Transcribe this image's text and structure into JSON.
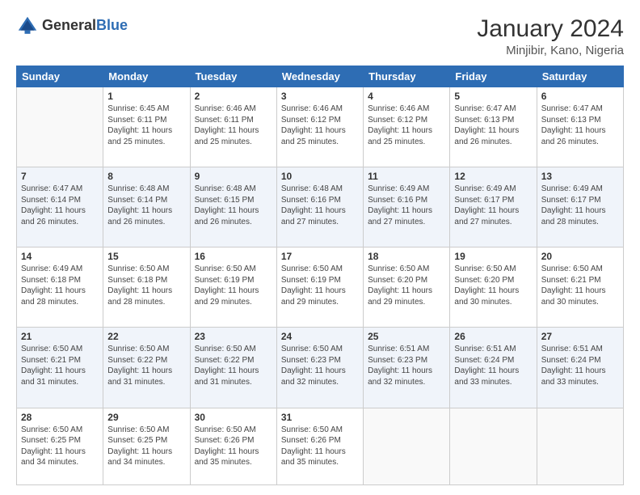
{
  "logo": {
    "text_general": "General",
    "text_blue": "Blue"
  },
  "header": {
    "month_year": "January 2024",
    "location": "Minjibir, Kano, Nigeria"
  },
  "weekdays": [
    "Sunday",
    "Monday",
    "Tuesday",
    "Wednesday",
    "Thursday",
    "Friday",
    "Saturday"
  ],
  "weeks": [
    [
      {
        "day": "",
        "sunrise": "",
        "sunset": "",
        "daylight": ""
      },
      {
        "day": "1",
        "sunrise": "Sunrise: 6:45 AM",
        "sunset": "Sunset: 6:11 PM",
        "daylight": "Daylight: 11 hours and 25 minutes."
      },
      {
        "day": "2",
        "sunrise": "Sunrise: 6:46 AM",
        "sunset": "Sunset: 6:11 PM",
        "daylight": "Daylight: 11 hours and 25 minutes."
      },
      {
        "day": "3",
        "sunrise": "Sunrise: 6:46 AM",
        "sunset": "Sunset: 6:12 PM",
        "daylight": "Daylight: 11 hours and 25 minutes."
      },
      {
        "day": "4",
        "sunrise": "Sunrise: 6:46 AM",
        "sunset": "Sunset: 6:12 PM",
        "daylight": "Daylight: 11 hours and 25 minutes."
      },
      {
        "day": "5",
        "sunrise": "Sunrise: 6:47 AM",
        "sunset": "Sunset: 6:13 PM",
        "daylight": "Daylight: 11 hours and 26 minutes."
      },
      {
        "day": "6",
        "sunrise": "Sunrise: 6:47 AM",
        "sunset": "Sunset: 6:13 PM",
        "daylight": "Daylight: 11 hours and 26 minutes."
      }
    ],
    [
      {
        "day": "7",
        "sunrise": "Sunrise: 6:47 AM",
        "sunset": "Sunset: 6:14 PM",
        "daylight": "Daylight: 11 hours and 26 minutes."
      },
      {
        "day": "8",
        "sunrise": "Sunrise: 6:48 AM",
        "sunset": "Sunset: 6:14 PM",
        "daylight": "Daylight: 11 hours and 26 minutes."
      },
      {
        "day": "9",
        "sunrise": "Sunrise: 6:48 AM",
        "sunset": "Sunset: 6:15 PM",
        "daylight": "Daylight: 11 hours and 26 minutes."
      },
      {
        "day": "10",
        "sunrise": "Sunrise: 6:48 AM",
        "sunset": "Sunset: 6:16 PM",
        "daylight": "Daylight: 11 hours and 27 minutes."
      },
      {
        "day": "11",
        "sunrise": "Sunrise: 6:49 AM",
        "sunset": "Sunset: 6:16 PM",
        "daylight": "Daylight: 11 hours and 27 minutes."
      },
      {
        "day": "12",
        "sunrise": "Sunrise: 6:49 AM",
        "sunset": "Sunset: 6:17 PM",
        "daylight": "Daylight: 11 hours and 27 minutes."
      },
      {
        "day": "13",
        "sunrise": "Sunrise: 6:49 AM",
        "sunset": "Sunset: 6:17 PM",
        "daylight": "Daylight: 11 hours and 28 minutes."
      }
    ],
    [
      {
        "day": "14",
        "sunrise": "Sunrise: 6:49 AM",
        "sunset": "Sunset: 6:18 PM",
        "daylight": "Daylight: 11 hours and 28 minutes."
      },
      {
        "day": "15",
        "sunrise": "Sunrise: 6:50 AM",
        "sunset": "Sunset: 6:18 PM",
        "daylight": "Daylight: 11 hours and 28 minutes."
      },
      {
        "day": "16",
        "sunrise": "Sunrise: 6:50 AM",
        "sunset": "Sunset: 6:19 PM",
        "daylight": "Daylight: 11 hours and 29 minutes."
      },
      {
        "day": "17",
        "sunrise": "Sunrise: 6:50 AM",
        "sunset": "Sunset: 6:19 PM",
        "daylight": "Daylight: 11 hours and 29 minutes."
      },
      {
        "day": "18",
        "sunrise": "Sunrise: 6:50 AM",
        "sunset": "Sunset: 6:20 PM",
        "daylight": "Daylight: 11 hours and 29 minutes."
      },
      {
        "day": "19",
        "sunrise": "Sunrise: 6:50 AM",
        "sunset": "Sunset: 6:20 PM",
        "daylight": "Daylight: 11 hours and 30 minutes."
      },
      {
        "day": "20",
        "sunrise": "Sunrise: 6:50 AM",
        "sunset": "Sunset: 6:21 PM",
        "daylight": "Daylight: 11 hours and 30 minutes."
      }
    ],
    [
      {
        "day": "21",
        "sunrise": "Sunrise: 6:50 AM",
        "sunset": "Sunset: 6:21 PM",
        "daylight": "Daylight: 11 hours and 31 minutes."
      },
      {
        "day": "22",
        "sunrise": "Sunrise: 6:50 AM",
        "sunset": "Sunset: 6:22 PM",
        "daylight": "Daylight: 11 hours and 31 minutes."
      },
      {
        "day": "23",
        "sunrise": "Sunrise: 6:50 AM",
        "sunset": "Sunset: 6:22 PM",
        "daylight": "Daylight: 11 hours and 31 minutes."
      },
      {
        "day": "24",
        "sunrise": "Sunrise: 6:50 AM",
        "sunset": "Sunset: 6:23 PM",
        "daylight": "Daylight: 11 hours and 32 minutes."
      },
      {
        "day": "25",
        "sunrise": "Sunrise: 6:51 AM",
        "sunset": "Sunset: 6:23 PM",
        "daylight": "Daylight: 11 hours and 32 minutes."
      },
      {
        "day": "26",
        "sunrise": "Sunrise: 6:51 AM",
        "sunset": "Sunset: 6:24 PM",
        "daylight": "Daylight: 11 hours and 33 minutes."
      },
      {
        "day": "27",
        "sunrise": "Sunrise: 6:51 AM",
        "sunset": "Sunset: 6:24 PM",
        "daylight": "Daylight: 11 hours and 33 minutes."
      }
    ],
    [
      {
        "day": "28",
        "sunrise": "Sunrise: 6:50 AM",
        "sunset": "Sunset: 6:25 PM",
        "daylight": "Daylight: 11 hours and 34 minutes."
      },
      {
        "day": "29",
        "sunrise": "Sunrise: 6:50 AM",
        "sunset": "Sunset: 6:25 PM",
        "daylight": "Daylight: 11 hours and 34 minutes."
      },
      {
        "day": "30",
        "sunrise": "Sunrise: 6:50 AM",
        "sunset": "Sunset: 6:26 PM",
        "daylight": "Daylight: 11 hours and 35 minutes."
      },
      {
        "day": "31",
        "sunrise": "Sunrise: 6:50 AM",
        "sunset": "Sunset: 6:26 PM",
        "daylight": "Daylight: 11 hours and 35 minutes."
      },
      {
        "day": "",
        "sunrise": "",
        "sunset": "",
        "daylight": ""
      },
      {
        "day": "",
        "sunrise": "",
        "sunset": "",
        "daylight": ""
      },
      {
        "day": "",
        "sunrise": "",
        "sunset": "",
        "daylight": ""
      }
    ]
  ]
}
